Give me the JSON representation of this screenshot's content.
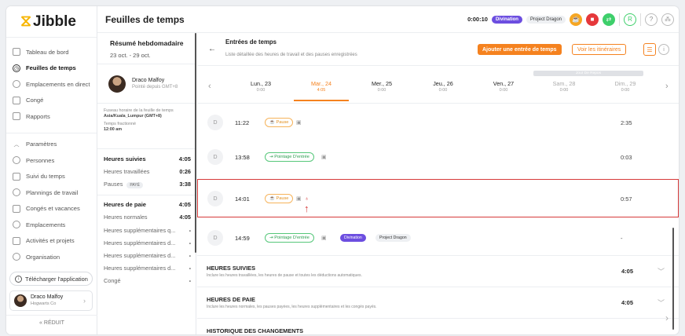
{
  "app": {
    "logo_text": "Jibble"
  },
  "nav": {
    "items": [
      {
        "label": "Tableau de bord",
        "icon": "dashboard-icon"
      },
      {
        "label": "Feuilles de temps",
        "icon": "clock-icon",
        "active": true
      },
      {
        "label": "Emplacements en direct",
        "icon": "location-icon"
      },
      {
        "label": "Congé",
        "icon": "calendar-icon"
      },
      {
        "label": "Rapports",
        "icon": "report-icon"
      }
    ],
    "settings": [
      {
        "label": "Paramètres",
        "icon": "chevron-up-icon"
      },
      {
        "label": "Personnes",
        "icon": "people-icon"
      },
      {
        "label": "Suivi du temps",
        "icon": "time-tracking-icon"
      },
      {
        "label": "Plannings de travail",
        "icon": "schedule-icon"
      },
      {
        "label": "Congés et vacances",
        "icon": "holiday-icon"
      },
      {
        "label": "Emplacements",
        "icon": "pin-icon"
      },
      {
        "label": "Activités et projets",
        "icon": "tag-icon"
      },
      {
        "label": "Organisation",
        "icon": "gear-icon"
      }
    ],
    "download_label": "Télécharger l'application",
    "user_name": "Draco Malfoy",
    "user_org": "Hogwarts Co",
    "collapse_label": "RÉDUIT"
  },
  "topbar": {
    "title": "Feuilles de temps",
    "timer": "0:00:10",
    "activity": "Divination",
    "project": "Project Dragon",
    "user_initials": "R"
  },
  "summary": {
    "title": "Résumé hebdomadaire",
    "range": "23 oct. - 29 oct.",
    "user_name": "Draco Malfoy",
    "user_status": "Pointé depuis GMT+8",
    "tz_label": "Fuseau horaire de la feuille de temps",
    "tz_value": "Asia/Kuala_Lumpur (GMT+8)",
    "split_label": "Temps fractionné",
    "split_value": "12:00 am",
    "tracked": [
      {
        "label": "Heures suivies",
        "value": "4:05",
        "header": true
      },
      {
        "label": "Heures travaillées",
        "value": "0:26"
      },
      {
        "label": "Pauses",
        "badge": "PAYÉ",
        "value": "3:38"
      }
    ],
    "pay": [
      {
        "label": "Heures de paie",
        "value": "4:05",
        "header": true
      },
      {
        "label": "Heures normales",
        "value": "4:05"
      },
      {
        "label": "Heures supplémentaires q...",
        "value": "-"
      },
      {
        "label": "Heures supplémentaires d...",
        "value": "-"
      },
      {
        "label": "Heures supplémentaires d...",
        "value": "-"
      },
      {
        "label": "Heures supplémentaires d...",
        "value": "-"
      },
      {
        "label": "Congé",
        "value": "-"
      }
    ]
  },
  "main": {
    "title": "Entrées de temps",
    "subtitle": "Liste détaillée des heures de travail et des pauses enregistrées",
    "add_button": "Ajouter une entrée de temps",
    "routes_button": "Voir les itinéraires",
    "rest_day": "Jour De Repos",
    "days": [
      {
        "name": "Lun., 23",
        "total": "0:00"
      },
      {
        "name": "Mar., 24",
        "total": "4:05",
        "active": true
      },
      {
        "name": "Mer., 25",
        "total": "0:00"
      },
      {
        "name": "Jeu., 26",
        "total": "0:00"
      },
      {
        "name": "Ven., 27",
        "total": "0:00"
      },
      {
        "name": "Sam., 28",
        "total": "0:00",
        "muted": true
      },
      {
        "name": "Dim., 29",
        "total": "0:00",
        "muted": true
      }
    ],
    "entries": [
      {
        "initial": "D",
        "time": "11:22",
        "type": "Pause",
        "duration": "2:35"
      },
      {
        "initial": "D",
        "time": "13:58",
        "type": "Pointage D'entrée",
        "duration": "0:03"
      },
      {
        "initial": "D",
        "time": "14:01",
        "type": "Pause",
        "duration": "0:57"
      },
      {
        "initial": "D",
        "time": "14:59",
        "type": "Pointage D'entrée",
        "activity": "Divination",
        "project": "Project Dragon",
        "duration": "-"
      }
    ],
    "sections": [
      {
        "title": "HEURES SUIVIES",
        "desc": "Inclure les heures travaillées, les heures de pause et toutes les déductions automatiques.",
        "value": "4:05"
      },
      {
        "title": "HEURES DE PAIE",
        "desc": "Inclure les heures normales, les pauses payées, les heures supplémentaires et les congés payés.",
        "value": "4:05"
      },
      {
        "title": "HISTORIQUE DES CHANGEMENTS",
        "desc": "",
        "value": ""
      }
    ]
  },
  "colors": {
    "accent": "#f5821f",
    "purple": "#6c4ee0",
    "highlight": "#d63a3a"
  }
}
